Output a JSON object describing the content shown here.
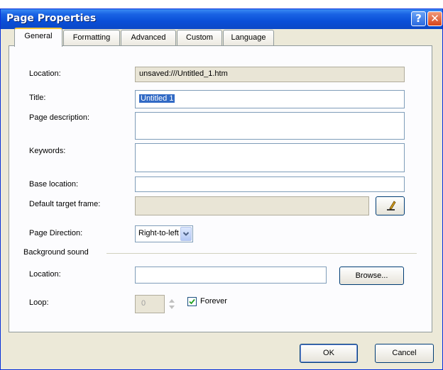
{
  "window": {
    "title": "Page Properties",
    "help_glyph": "?",
    "close_glyph": "✕"
  },
  "tabs": [
    {
      "label": "General"
    },
    {
      "label": "Formatting"
    },
    {
      "label": "Advanced"
    },
    {
      "label": "Custom"
    },
    {
      "label": "Language"
    }
  ],
  "general": {
    "location_label": "Location:",
    "location_value": "unsaved:///Untitled_1.htm",
    "title_label": "Title:",
    "title_value": "Untitled 1",
    "page_description_label": "Page description:",
    "keywords_label": "Keywords:",
    "base_location_label": "Base location:",
    "default_target_frame_label": "Default target frame:",
    "page_direction_label": "Page Direction:",
    "page_direction_value": "Right-to-left",
    "background_sound": {
      "section_label": "Background sound",
      "location_label": "Location:",
      "browse_label": "Browse...",
      "loop_label": "Loop:",
      "loop_value": "0",
      "forever_label": "Forever",
      "forever_checked": true
    }
  },
  "buttons": {
    "ok": "OK",
    "cancel": "Cancel"
  }
}
